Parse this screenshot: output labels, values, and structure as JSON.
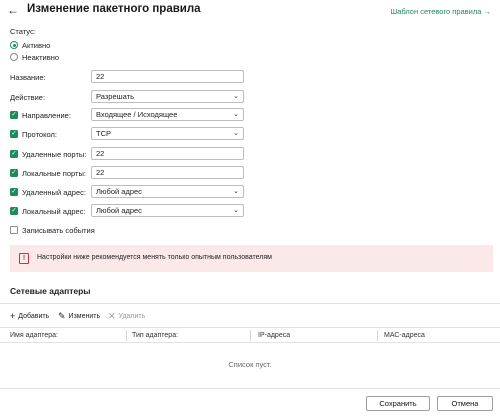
{
  "header": {
    "back_icon": "arrow-left-icon",
    "title": "Изменение пакетного правила",
    "template_link": "Шаблон сетевого правила →"
  },
  "status": {
    "label": "Статус:",
    "options": [
      "Активно",
      "Неактивно"
    ],
    "selected": "Активно"
  },
  "form": {
    "name_label": "Название:",
    "name_value": "22",
    "action_label": "Действие:",
    "action_value": "Разрешать",
    "direction_label": "Направление:",
    "direction_value": "Входящее / Исходящее",
    "protocol_label": "Протокол:",
    "protocol_value": "TCP",
    "remote_ports_label": "Удаленные порты:",
    "remote_ports_value": "22",
    "local_ports_label": "Локальные порты:",
    "local_ports_value": "22",
    "remote_address_label": "Удаленный адрес:",
    "remote_address_value": "Любой адрес",
    "local_address_label": "Локальный адрес:",
    "local_address_value": "Любой адрес",
    "log_events_label": "Записывать события",
    "checked": {
      "direction": true,
      "protocol": true,
      "remote_ports": true,
      "local_ports": true,
      "remote_address": true,
      "local_address": true,
      "log_events": false
    }
  },
  "warning": {
    "text": "Настройки ниже рекомендуется менять только опытным пользователям",
    "color": "#d0313b"
  },
  "adapters": {
    "title": "Сетевые адаптеры",
    "toolbar": {
      "add": "Добавить",
      "edit": "Изменить",
      "delete": "Удалить"
    },
    "columns": [
      "Имя адаптера:",
      "Тип адаптера:",
      "IP-адреса",
      "МАС-адреса"
    ],
    "empty_text": "Список пуст."
  },
  "footer": {
    "save": "Сохранить",
    "cancel": "Отмена"
  },
  "colors": {
    "accent": "#1f8a5b",
    "warning_bg": "#fbe9ea"
  }
}
